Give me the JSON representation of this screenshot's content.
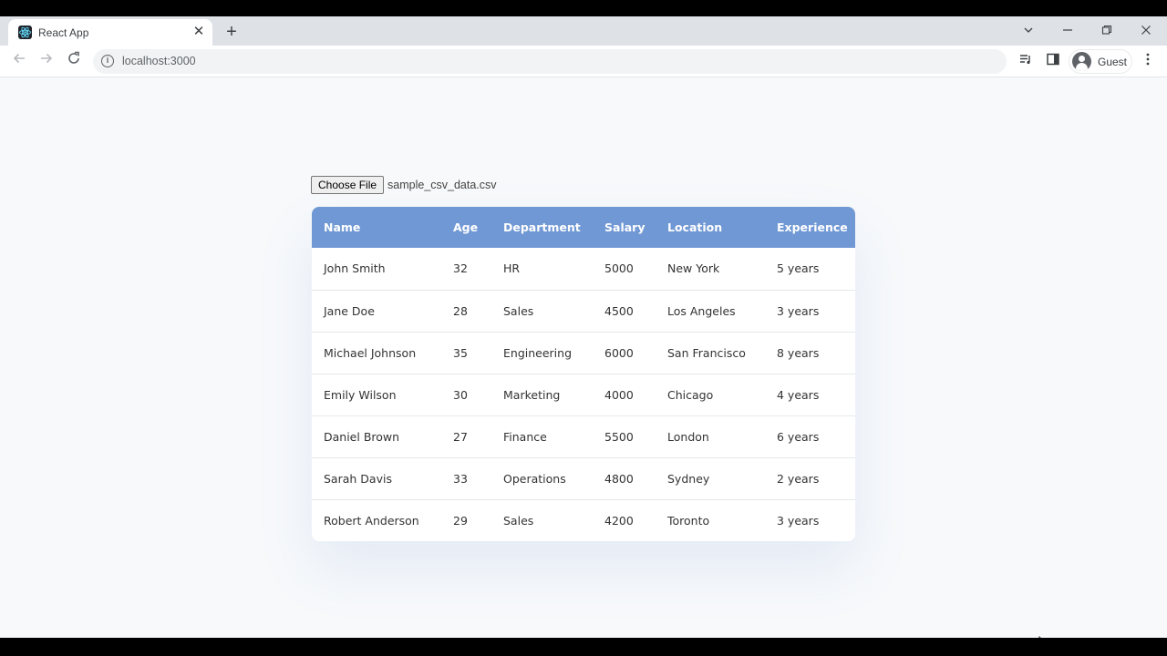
{
  "browser": {
    "tab_title": "React App",
    "tab_close": "✕",
    "new_tab": "+",
    "url": "localhost:3000",
    "profile_name": "Guest",
    "icons": [
      "react-favicon-icon",
      "back-arrow-icon",
      "forward-arrow-icon",
      "reload-icon",
      "info-icon",
      "media-queue-icon",
      "side-panel-icon",
      "account-icon",
      "kebab-menu-icon",
      "chevron-down-icon",
      "minimize-icon",
      "restore-icon",
      "close-icon"
    ]
  },
  "upload": {
    "button_label": "Choose File",
    "file_name": "sample_csv_data.csv"
  },
  "table": {
    "headers": [
      "Name",
      "Age",
      "Department",
      "Salary",
      "Location",
      "Experience"
    ],
    "rows": [
      [
        "John Smith",
        "32",
        "HR",
        "5000",
        "New York",
        "5 years"
      ],
      [
        "Jane Doe",
        "28",
        "Sales",
        "4500",
        "Los Angeles",
        "3 years"
      ],
      [
        "Michael Johnson",
        "35",
        "Engineering",
        "6000",
        "San Francisco",
        "8 years"
      ],
      [
        "Emily Wilson",
        "30",
        "Marketing",
        "4000",
        "Chicago",
        "4 years"
      ],
      [
        "Daniel Brown",
        "27",
        "Finance",
        "5500",
        "London",
        "6 years"
      ],
      [
        "Sarah Davis",
        "33",
        "Operations",
        "4800",
        "Sydney",
        "2 years"
      ],
      [
        "Robert Anderson",
        "29",
        "Sales",
        "4200",
        "Toronto",
        "3 years"
      ]
    ]
  },
  "colors": {
    "header_bg": "#7098d4",
    "page_bg": "#f7f9fb"
  }
}
